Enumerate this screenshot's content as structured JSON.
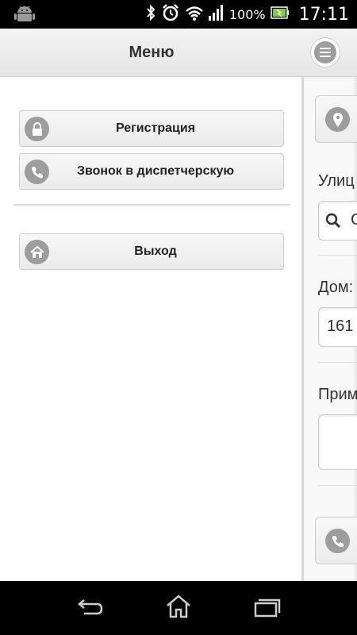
{
  "status_bar": {
    "battery_percent": "100%",
    "time": "17:11",
    "icons": [
      "android-icon",
      "bluetooth-icon",
      "alarm-icon",
      "wifi-icon",
      "signal-icon",
      "battery-icon"
    ]
  },
  "header": {
    "title": "Меню",
    "menu_icon": "list-icon"
  },
  "menu": {
    "items": [
      {
        "label": "Регистрация",
        "icon": "lock-icon"
      },
      {
        "label": "Звонок в диспетчерскую",
        "icon": "phone-icon"
      },
      {
        "label": "Выход",
        "icon": "home-icon"
      }
    ]
  },
  "content": {
    "street_label": "Улиц",
    "street_value": "С",
    "house_label": "Дом:",
    "house_value": "161",
    "note_label": "Прим"
  },
  "nav_bar": {
    "icons": [
      "back-icon",
      "home-icon",
      "recent-apps-icon"
    ]
  },
  "colors": {
    "icon_gray": "#9d9d9d",
    "header_bg": "#ececec",
    "status_bg": "#000000"
  }
}
